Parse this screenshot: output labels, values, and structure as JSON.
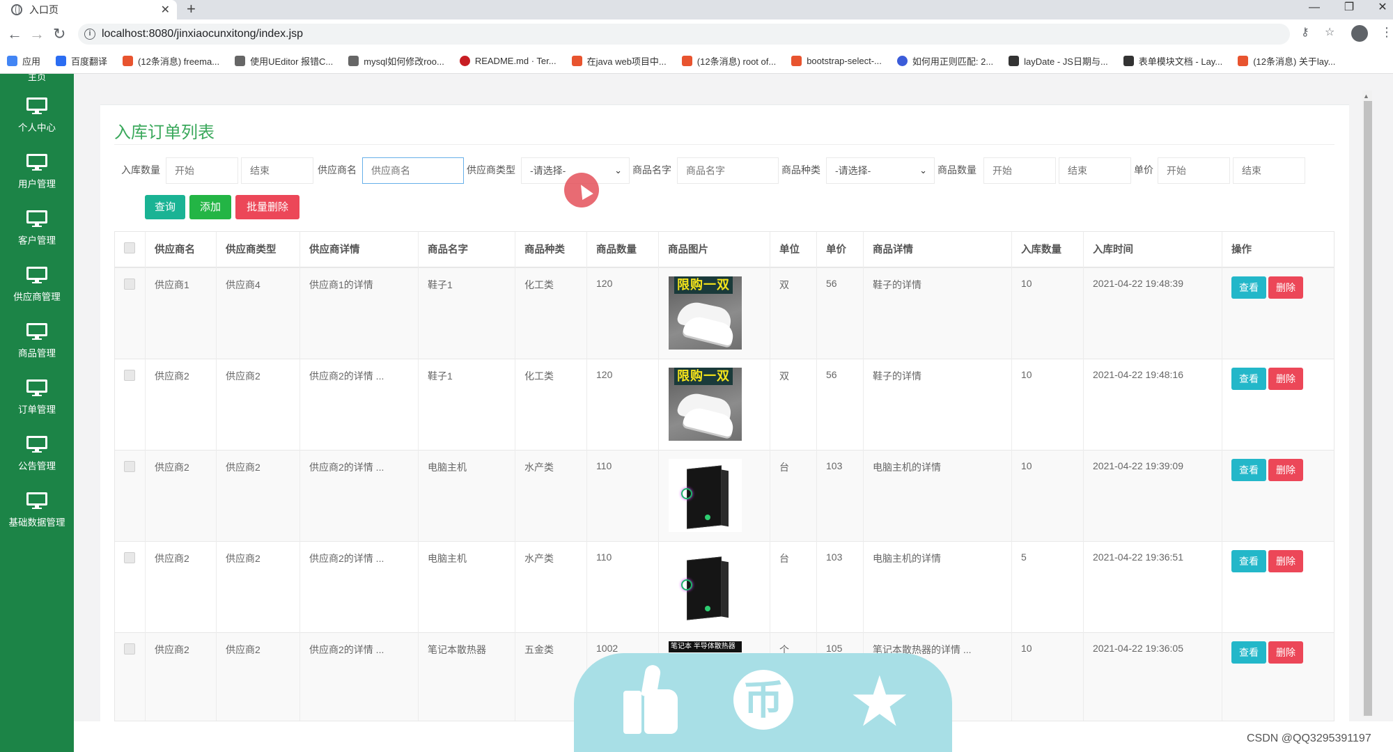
{
  "browser": {
    "tab_title": "入口页",
    "url": "localhost:8080/jinxiaocunxitong/index.jsp",
    "bookmarks": [
      {
        "label": "应用",
        "color": "#4285f4"
      },
      {
        "label": "百度翻译",
        "color": "#2b6df2"
      },
      {
        "label": "(12条消息) freema...",
        "color": "#e8542f"
      },
      {
        "label": "使用UEditor 报错C...",
        "color": "#333333"
      },
      {
        "label": "mysql如何修改roo...",
        "color": "#333333"
      },
      {
        "label": "README.md · Ter...",
        "color": "#c71d23"
      },
      {
        "label": "在java web项目中...",
        "color": "#e8542f"
      },
      {
        "label": "(12条消息) root of...",
        "color": "#e8542f"
      },
      {
        "label": "bootstrap-select-...",
        "color": "#e8542f"
      },
      {
        "label": "如何用正则匹配: 2...",
        "color": "#3b5cd9"
      },
      {
        "label": "layDate - JS日期与...",
        "color": "#333333"
      },
      {
        "label": "表单模块文档 - Lay...",
        "color": "#333333"
      },
      {
        "label": "(12条消息) 关于lay...",
        "color": "#e8542f"
      }
    ]
  },
  "sidebar": {
    "top_label": "主页",
    "items": [
      {
        "label": "个人中心"
      },
      {
        "label": "用户管理"
      },
      {
        "label": "客户管理"
      },
      {
        "label": "供应商管理"
      },
      {
        "label": "商品管理"
      },
      {
        "label": "订单管理"
      },
      {
        "label": "公告管理"
      },
      {
        "label": "基础数据管理"
      }
    ]
  },
  "page": {
    "title": "入库订单列表"
  },
  "filters": {
    "in_qty_label": "入库数量",
    "supplier_name_label": "供应商名",
    "supplier_type_label": "供应商类型",
    "goods_name_label": "商品名字",
    "goods_kind_label": "商品种类",
    "goods_qty_label": "商品数量",
    "price_label": "单价",
    "start_placeholder": "开始",
    "end_placeholder": "结束",
    "supplier_name_placeholder": "供应商名",
    "goods_name_placeholder": "商品名字",
    "select_placeholder": "-请选择-"
  },
  "actions": {
    "query": "查询",
    "add": "添加",
    "batch_delete": "批量删除"
  },
  "table": {
    "headers": {
      "supplier_name": "供应商名",
      "supplier_type": "供应商类型",
      "supplier_detail": "供应商详情",
      "goods_name": "商品名字",
      "goods_kind": "商品种类",
      "goods_qty": "商品数量",
      "goods_image": "商品图片",
      "unit": "单位",
      "price": "单价",
      "goods_detail": "商品详情",
      "in_qty": "入库数量",
      "in_time": "入库时间",
      "ops": "操作"
    },
    "view_label": "查看",
    "delete_label": "删除",
    "rows": [
      {
        "supplier_name": "供应商1",
        "supplier_type": "供应商4",
        "supplier_detail": "供应商1的详情",
        "goods_name": "鞋子1",
        "goods_kind": "化工类",
        "goods_qty": "120",
        "image": "shoe",
        "image_text": "限购一双",
        "unit": "双",
        "price": "56",
        "goods_detail": "鞋子的详情",
        "in_qty": "10",
        "in_time": "2021-04-22 19:48:39"
      },
      {
        "supplier_name": "供应商2",
        "supplier_type": "供应商2",
        "supplier_detail": "供应商2的详情 ...",
        "goods_name": "鞋子1",
        "goods_kind": "化工类",
        "goods_qty": "120",
        "image": "shoe",
        "image_text": "限购一双",
        "unit": "双",
        "price": "56",
        "goods_detail": "鞋子的详情",
        "in_qty": "10",
        "in_time": "2021-04-22 19:48:16"
      },
      {
        "supplier_name": "供应商2",
        "supplier_type": "供应商2",
        "supplier_detail": "供应商2的详情 ...",
        "goods_name": "电脑主机",
        "goods_kind": "水产类",
        "goods_qty": "110",
        "image": "pc",
        "image_text": "",
        "unit": "台",
        "price": "103",
        "goods_detail": "电脑主机的详情",
        "in_qty": "10",
        "in_time": "2021-04-22 19:39:09"
      },
      {
        "supplier_name": "供应商2",
        "supplier_type": "供应商2",
        "supplier_detail": "供应商2的详情 ...",
        "goods_name": "电脑主机",
        "goods_kind": "水产类",
        "goods_qty": "110",
        "image": "pc",
        "image_text": "",
        "unit": "台",
        "price": "103",
        "goods_detail": "电脑主机的详情",
        "in_qty": "5",
        "in_time": "2021-04-22 19:36:51"
      },
      {
        "supplier_name": "供应商2",
        "supplier_type": "供应商2",
        "supplier_detail": "供应商2的详情 ...",
        "goods_name": "笔记本散热器",
        "goods_kind": "五金类",
        "goods_qty": "1002",
        "image": "cooler",
        "image_text": "笔记本 半导体散热器",
        "unit": "个",
        "price": "105",
        "goods_detail": "笔记本散热器的详情 ...",
        "in_qty": "10",
        "in_time": "2021-04-22 19:36:05"
      }
    ]
  },
  "overlay": {
    "icons": [
      "thumbs-up-icon",
      "coin-icon",
      "star-icon"
    ],
    "coin_glyph": "币"
  },
  "watermark": "CSDN @QQ3295391197",
  "colors": {
    "sidebar": "#1c8447",
    "title": "#3aa85b",
    "query": "#1ab394",
    "add": "#23b545",
    "danger": "#ec4758",
    "view": "#23b7c9",
    "overlay": "#a8dfe6"
  }
}
